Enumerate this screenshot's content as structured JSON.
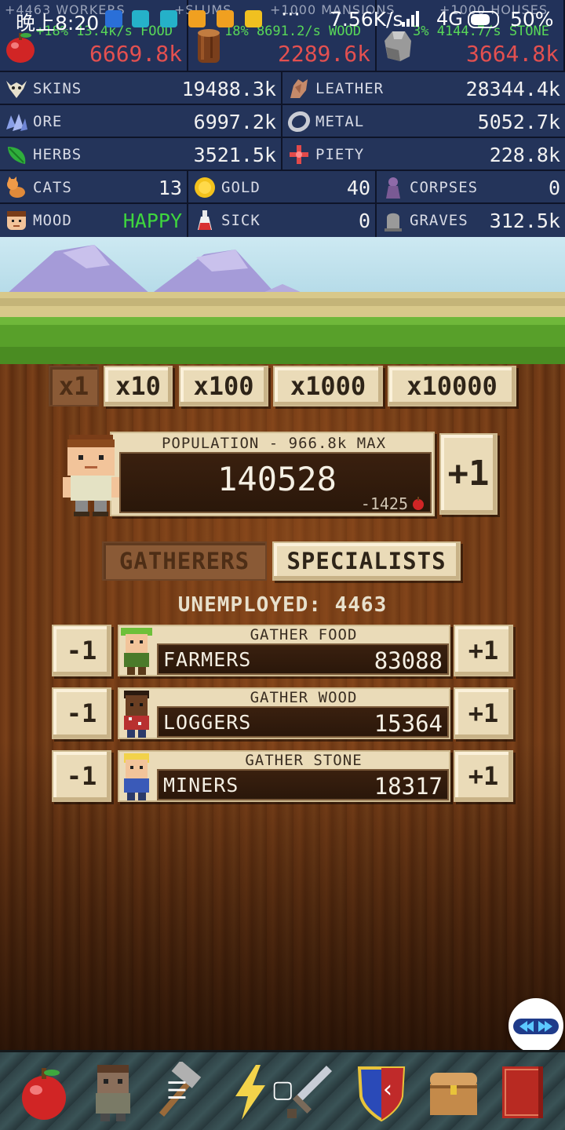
{
  "status_bar": {
    "time": "晚上8:20",
    "net_speed": "7.56K/s",
    "network": "4G",
    "battery": "50%",
    "dots": "···",
    "faint_texts": [
      "+4463 WORKERS",
      "+SLUMS",
      "+1000 MANSIONS",
      "+1000 HOUSES"
    ]
  },
  "resources_top": [
    {
      "rate": "+18% 13.4k/s FOOD",
      "amount": "6669.8k",
      "icon": "apple-icon"
    },
    {
      "rate": "18% 8691.2/s WOOD",
      "amount": "2289.6k",
      "icon": "wood-log-icon"
    },
    {
      "rate": "3% 4144.7/s STONE",
      "amount": "3664.8k",
      "icon": "stone-icon"
    }
  ],
  "resources_mid": [
    {
      "label": "SKINS",
      "value": "19488.3k",
      "icon": "skull-icon"
    },
    {
      "label": "LEATHER",
      "value": "28344.4k",
      "icon": "leather-icon"
    },
    {
      "label": "ORE",
      "value": "6997.2k",
      "icon": "ore-icon"
    },
    {
      "label": "METAL",
      "value": "5052.7k",
      "icon": "metal-icon"
    },
    {
      "label": "HERBS",
      "value": "3521.5k",
      "icon": "herb-icon"
    },
    {
      "label": "PIETY",
      "value": "228.8k",
      "icon": "piety-icon"
    }
  ],
  "resources_small": [
    {
      "label": "CATS",
      "value": "13",
      "icon": "cat-icon"
    },
    {
      "label": "GOLD",
      "value": "40",
      "icon": "gold-coin-icon"
    },
    {
      "label": "CORPSES",
      "value": "0",
      "icon": "corpse-icon"
    },
    {
      "label": "MOOD",
      "value": "HAPPY",
      "icon": "face-icon"
    },
    {
      "label": "SICK",
      "value": "0",
      "icon": "potion-icon"
    },
    {
      "label": "GRAVES",
      "value": "312.5k",
      "icon": "gravestone-icon"
    }
  ],
  "multipliers": [
    "x1",
    "x10",
    "x100",
    "x1000",
    "x10000"
  ],
  "population": {
    "title": "POPULATION -  966.8k MAX",
    "value": "140528",
    "rate": "-1425",
    "add_label": "+1"
  },
  "tabs": {
    "gatherers": "GATHERERS",
    "specialists": "SPECIALISTS"
  },
  "unemployed": "UNEMPLOYED: 4463",
  "jobs": [
    {
      "task": "GATHER FOOD",
      "name": "FARMERS",
      "count": "83088",
      "minus": "-1",
      "plus": "+1"
    },
    {
      "task": "GATHER WOOD",
      "name": "LOGGERS",
      "count": "15364",
      "minus": "-1",
      "plus": "+1"
    },
    {
      "task": "GATHER STONE",
      "name": "MINERS",
      "count": "18317",
      "minus": "-1",
      "plus": "+1"
    }
  ],
  "bottom_nav": [
    "apple-icon",
    "person-icon",
    "hammer-icon",
    "lightning-icon",
    "sword-icon",
    "shield-icon",
    "chest-icon",
    "book-icon"
  ],
  "colors": {
    "food_amount": "#e35050",
    "rate_green": "#58d858",
    "mood_happy": "#3ed63e",
    "panel_blue": "#24345a",
    "parchment": "#eadbb8"
  }
}
